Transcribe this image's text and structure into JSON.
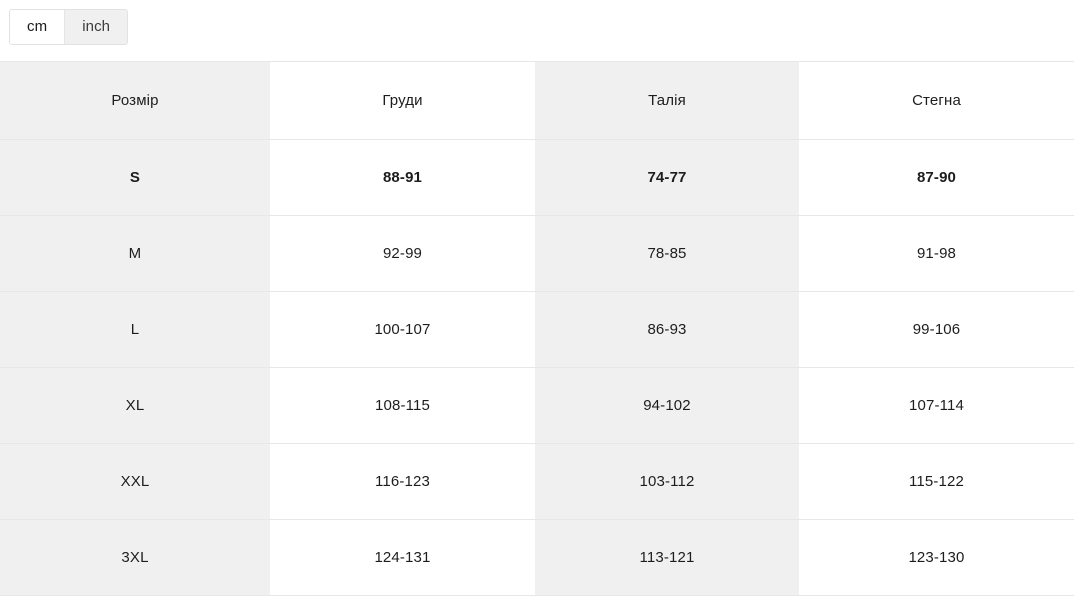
{
  "unit_toggle": {
    "name": "unit-toggle",
    "options": [
      {
        "label": "cm",
        "active": true
      },
      {
        "label": "inch",
        "active": false
      }
    ]
  },
  "size_table": {
    "columns": [
      {
        "label": "Розмір",
        "shaded": true
      },
      {
        "label": "Груди",
        "shaded": false
      },
      {
        "label": "Талія",
        "shaded": true
      },
      {
        "label": "Стегна",
        "shaded": false
      }
    ],
    "rows": [
      {
        "emphasis": true,
        "cells": [
          "S",
          "88-91",
          "74-77",
          "87-90"
        ]
      },
      {
        "emphasis": false,
        "cells": [
          "M",
          "92-99",
          "78-85",
          "91-98"
        ]
      },
      {
        "emphasis": false,
        "cells": [
          "L",
          "100-107",
          "86-93",
          "99-106"
        ]
      },
      {
        "emphasis": false,
        "cells": [
          "XL",
          "108-115",
          "94-102",
          "107-114"
        ]
      },
      {
        "emphasis": false,
        "cells": [
          "XXL",
          "116-123",
          "103-112",
          "115-122"
        ]
      },
      {
        "emphasis": false,
        "cells": [
          "3XL",
          "124-131",
          "113-121",
          "123-130"
        ]
      }
    ]
  },
  "colors": {
    "shaded_cell": "#f0f0f0",
    "plain_cell": "#ffffff",
    "border": "#e7e7e7",
    "text": "#1d1d1d",
    "tab_inactive_bg": "#f0f0f0",
    "tab_active_bg": "#ffffff"
  }
}
